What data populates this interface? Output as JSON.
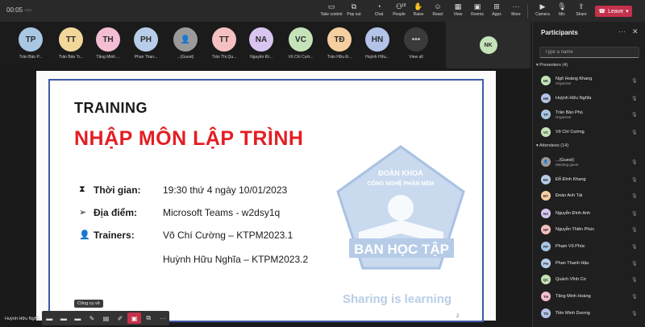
{
  "topbar": {
    "clock": "00:05",
    "buttons": [
      {
        "label": "Take control",
        "icon": "take-control-icon"
      },
      {
        "label": "Pop out",
        "icon": "pop-out-icon"
      },
      {
        "label": "Chat",
        "icon": "chat-icon"
      },
      {
        "label": "People",
        "icon": "people-icon",
        "count": "18"
      },
      {
        "label": "Raise",
        "icon": "raise-hand-icon"
      },
      {
        "label": "React",
        "icon": "react-icon"
      },
      {
        "label": "View",
        "icon": "view-icon"
      },
      {
        "label": "Rooms",
        "icon": "rooms-icon"
      },
      {
        "label": "Apps",
        "icon": "apps-icon"
      },
      {
        "label": "More",
        "icon": "more-icon"
      },
      {
        "label": "Camera",
        "icon": "camera-off-icon"
      },
      {
        "label": "Mic",
        "icon": "mic-off-icon"
      },
      {
        "label": "Share",
        "icon": "share-icon"
      }
    ],
    "leave_label": "Leave",
    "leave_color": "#c4314b"
  },
  "gallery": {
    "tiles": [
      {
        "initials": "TP",
        "name": "Trần Bảo P...",
        "color": "#a9c6e3"
      },
      {
        "initials": "TT",
        "name": "Trần Bảo Tr...",
        "color": "#f2d79a"
      },
      {
        "initials": "TH",
        "name": "Tăng Minh ...",
        "color": "#f3bdd4"
      },
      {
        "initials": "PH",
        "name": "Phan Than...",
        "color": "#b7cde8"
      },
      {
        "initials": "",
        "name": "...(Guest)",
        "color": "#9a9a9a"
      },
      {
        "initials": "TT",
        "name": "Trần Thị Qu...",
        "color": "#f5c0c0"
      },
      {
        "initials": "NA",
        "name": "Nguyễn Đì...",
        "color": "#d9c6f0"
      },
      {
        "initials": "VC",
        "name": "Võ Chí Cườ...",
        "color": "#c5e3b8"
      },
      {
        "initials": "TĐ",
        "name": "Trần Hữu Đ...",
        "color": "#f5cfa0"
      },
      {
        "initials": "HN",
        "name": "Huỳnh Hữu...",
        "color": "#b3c3e8"
      },
      {
        "initials": "•••",
        "name": "View all",
        "color": "#3a3a3a"
      }
    ],
    "spotlight_initials": "NK"
  },
  "slide": {
    "title1": "TRAINING",
    "title2": "NHẬP MÔN LẬP TRÌNH",
    "rows": [
      {
        "label": "Thời gian:",
        "value": "19:30 thứ 4 ngày 10/01/2023"
      },
      {
        "label": "Địa điểm:",
        "value": "Microsoft Teams - w2dsy1q"
      },
      {
        "label": "Trainers:",
        "value": "Võ Chí Cường – KTPM2023.1"
      }
    ],
    "trainer2": "Huỳnh Hữu Nghĩa – KTPM2023.2",
    "logo_top1": "ĐOÀN KHOA",
    "logo_top2": "CÔNG NGHỆ PHẦN MỀM",
    "logo_main": "BAN HỌC TẬP",
    "tagline": "Sharing is learning",
    "page_number": "2"
  },
  "bottom": {
    "presenter_name": "Huỳnh Hữu Nghĩa",
    "tooltip": "Công cụ vẽ"
  },
  "panel": {
    "title": "Participants",
    "search_placeholder": "Type a name",
    "presenters_label": "Presenters (4)",
    "attendees_label": "Attendees (14)",
    "presenters": [
      {
        "initials": "NK",
        "name": "Ngô Hoàng Khang",
        "role": "Organizer",
        "color": "#c5e3b8"
      },
      {
        "initials": "HN",
        "name": "Huỳnh Hữu Nghĩa",
        "role": "",
        "color": "#b3c3e8"
      },
      {
        "initials": "TP",
        "name": "Trần Bảo Phú",
        "role": "Organizer",
        "color": "#a9c6e3"
      },
      {
        "initials": "VC",
        "name": "Võ Chí Cường",
        "role": "",
        "color": "#c5e3b8"
      }
    ],
    "attendees": [
      {
        "initials": "",
        "name": "...(Guest)",
        "role": "Meeting guest",
        "color": "#9a9a9a"
      },
      {
        "initials": "ĐK",
        "name": "Đỗ Đình Khang",
        "role": "",
        "color": "#b7cde8"
      },
      {
        "initials": "ĐT",
        "name": "Đoàn Anh Tài",
        "role": "",
        "color": "#f5cfa0"
      },
      {
        "initials": "NA",
        "name": "Nguyễn Đình Anh",
        "role": "",
        "color": "#d9c6f0"
      },
      {
        "initials": "NP",
        "name": "Nguyễn Thiên Phúc",
        "role": "",
        "color": "#f5c0c0"
      },
      {
        "initials": "PP",
        "name": "Phạm Vũ Phúc",
        "role": "",
        "color": "#a9c6e3"
      },
      {
        "initials": "PH",
        "name": "Phan Thanh Hậu",
        "role": "",
        "color": "#b7cde8"
      },
      {
        "initials": "QC",
        "name": "Quách Vĩnh Cơ",
        "role": "",
        "color": "#c5e3b8"
      },
      {
        "initials": "TH",
        "name": "Tăng Minh Hoàng",
        "role": "",
        "color": "#f3bdd4"
      },
      {
        "initials": "TD",
        "name": "Tiền Minh Dương",
        "role": "",
        "color": "#b3c3e8"
      }
    ]
  }
}
